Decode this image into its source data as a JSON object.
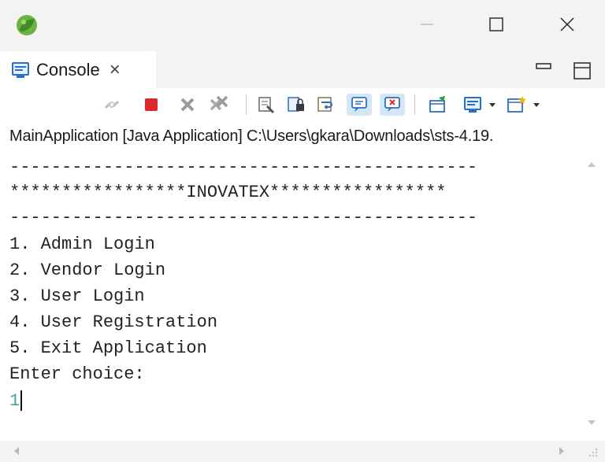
{
  "window": {
    "logo_icon": "spring-tools-logo-icon",
    "minimize_icon": "minimize-icon",
    "maximize_icon": "maximize-icon",
    "close_icon": "close-icon"
  },
  "tab": {
    "label": "Console",
    "icon": "console-icon",
    "close_glyph": "×"
  },
  "view_controls": {
    "minimize_icon": "view-minimize-icon",
    "maximize_icon": "view-maximize-icon"
  },
  "toolbar": {
    "buttons": [
      "disconnect-icon",
      "terminate-icon",
      "remove-launch-icon",
      "remove-all-terminated-icon",
      "clear-console-icon",
      "scroll-lock-icon",
      "word-wrap-icon",
      "show-on-stdout-icon",
      "show-on-stderr-icon",
      "pin-console-icon",
      "display-console-icon",
      "open-console-icon"
    ]
  },
  "process_label": "MainApplication [Java Application] C:\\Users\\gkara\\Downloads\\sts-4.19.",
  "console": {
    "lines": [
      "---------------------------------------------",
      "*****************INOVATEX*****************",
      "---------------------------------------------",
      "1. Admin Login",
      "2. Vendor Login",
      "3. User Login",
      "4. User Registration",
      "5. Exit Application",
      "Enter choice:"
    ],
    "user_input": "1"
  },
  "colors": {
    "chrome": "#f3f3f3",
    "input_text": "#3aa8a0",
    "terminate_red": "#e0282e"
  }
}
